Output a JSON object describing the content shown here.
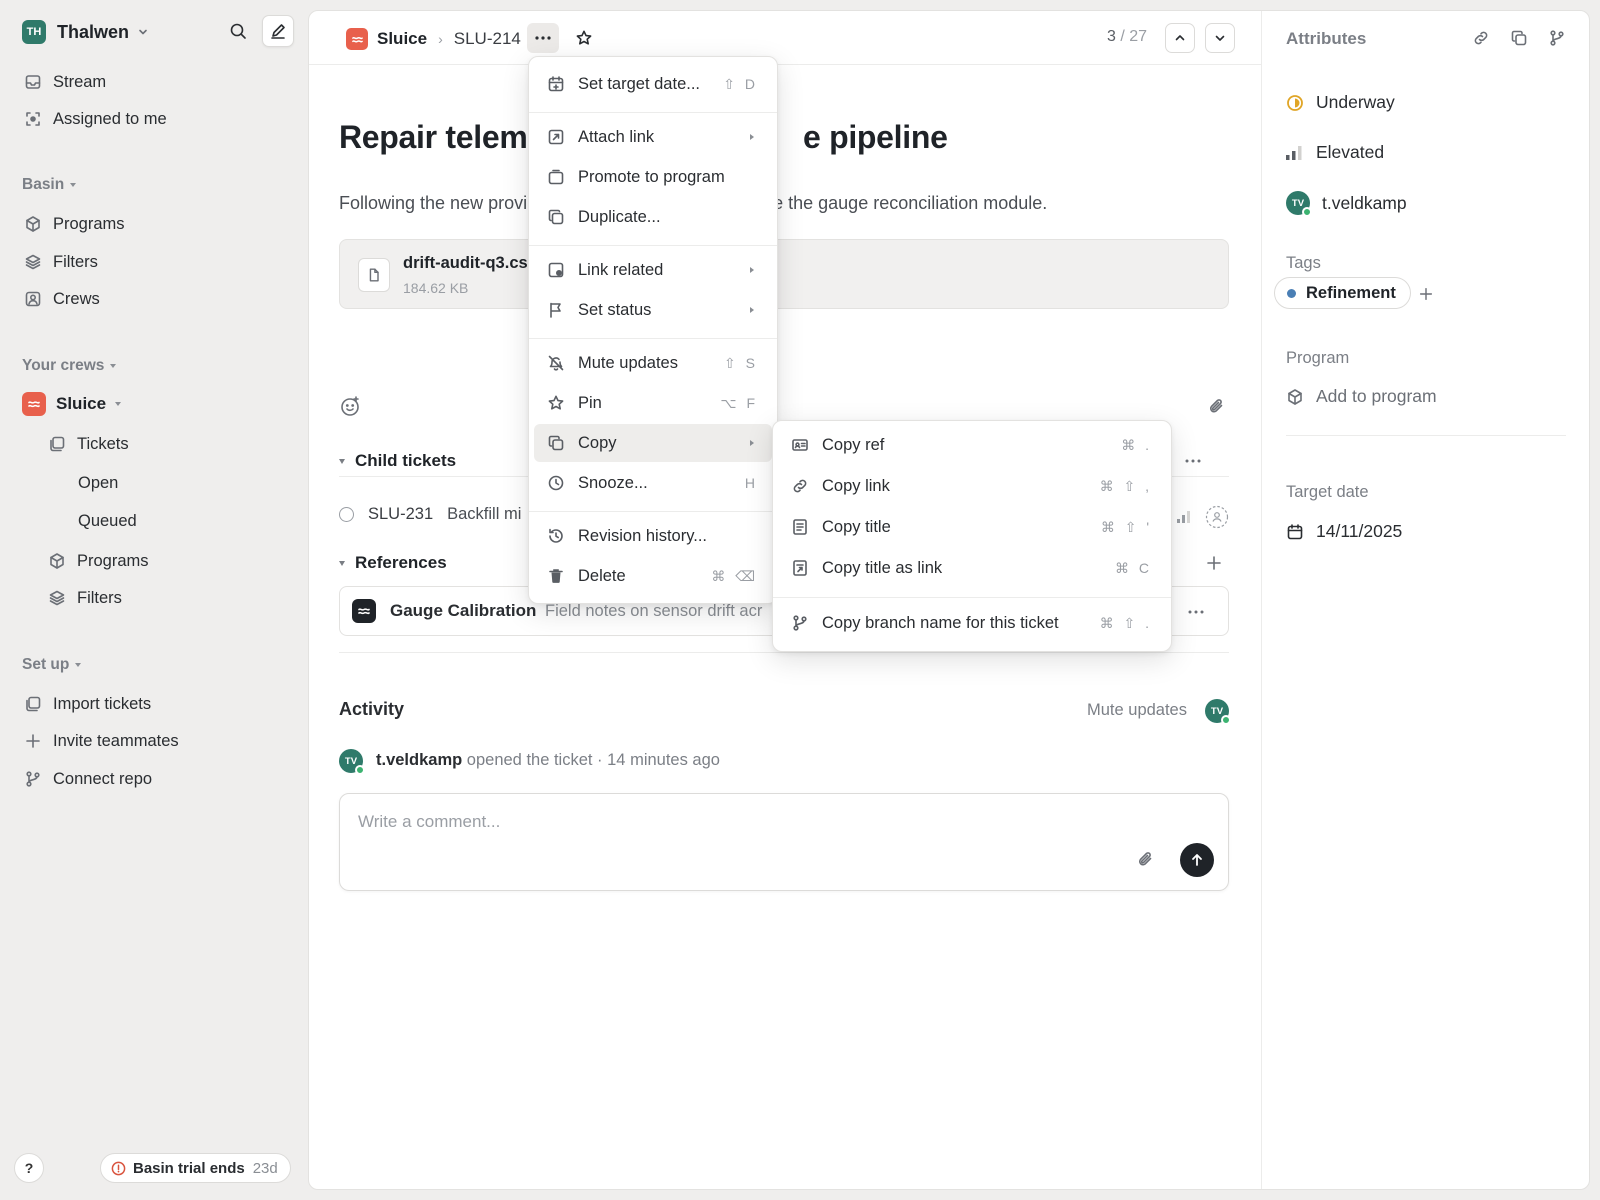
{
  "sidebar": {
    "workspace": {
      "initials": "TH",
      "name": "Thalwen"
    },
    "top_nav": [
      {
        "label": "Stream",
        "icon": "inbox-icon"
      },
      {
        "label": "Assigned to me",
        "icon": "target-icon"
      }
    ],
    "basin": {
      "label": "Basin",
      "items": [
        {
          "label": "Programs",
          "icon": "cube-icon"
        },
        {
          "label": "Filters",
          "icon": "layers-icon"
        },
        {
          "label": "Crews",
          "icon": "crew-icon"
        }
      ]
    },
    "your_crews": {
      "label": "Your crews",
      "crew": {
        "name": "Sluice"
      },
      "tickets_label": "Tickets",
      "ticket_sub": [
        "Open",
        "Queued"
      ],
      "programs_label": "Programs",
      "filters_label": "Filters"
    },
    "setup": {
      "label": "Set up",
      "items": [
        {
          "label": "Import tickets",
          "icon": "import-icon"
        },
        {
          "label": "Invite teammates",
          "icon": "plus-icon"
        },
        {
          "label": "Connect repo",
          "icon": "branch-icon"
        }
      ]
    },
    "help_label": "?",
    "trial": {
      "text": "Basin trial ends",
      "days": "23d"
    }
  },
  "header": {
    "crew": "Sluice",
    "ticket_id": "SLU-214",
    "pager_current": "3",
    "pager_total": "/ 27"
  },
  "ticket": {
    "title_left": "Repair teleme",
    "title_right": "e pipeline",
    "desc_left": "Following the new provi",
    "desc_right": "e the gauge reconciliation module.",
    "attachment": {
      "name": "drift-audit-q3.cs",
      "size": "184.62 KB"
    },
    "child_tickets_label": "Child tickets",
    "child": {
      "id": "SLU-231",
      "title": "Backfill mi"
    },
    "references_label": "References",
    "reference": {
      "title": "Gauge Calibration",
      "note": "Field notes on sensor drift acr"
    }
  },
  "activity": {
    "label": "Activity",
    "mute_label": "Mute updates",
    "user": "t.veldkamp",
    "initials": "TV",
    "event": "opened the ticket · 14 minutes ago",
    "comment_placeholder": "Write a comment..."
  },
  "attributes": {
    "header": "Attributes",
    "status": "Underway",
    "priority": "Elevated",
    "assignee": "t.veldkamp",
    "assignee_initials": "TV",
    "tags_label": "Tags",
    "tag": "Refinement",
    "program_label": "Program",
    "add_program": "Add to program",
    "target_label": "Target date",
    "target_date": "14/11/2025"
  },
  "context_menu": [
    {
      "label": "Set target date...",
      "shortcut": "⇧ D",
      "icon": "calendar-plus-icon"
    },
    {
      "label": "Attach link",
      "submenu": true,
      "icon": "attach-link-icon"
    },
    {
      "label": "Promote to program",
      "icon": "promote-icon"
    },
    {
      "label": "Duplicate...",
      "icon": "duplicate-icon"
    },
    {
      "label": "Link related",
      "submenu": true,
      "icon": "link-related-icon"
    },
    {
      "label": "Set status",
      "submenu": true,
      "icon": "flag-icon"
    },
    {
      "label": "Mute updates",
      "shortcut": "⇧ S",
      "icon": "bell-off-icon"
    },
    {
      "label": "Pin",
      "shortcut": "⌥ F",
      "icon": "star-icon"
    },
    {
      "label": "Copy",
      "submenu": true,
      "icon": "copy-icon"
    },
    {
      "label": "Snooze...",
      "shortcut": "H",
      "icon": "clock-icon"
    },
    {
      "label": "Revision history...",
      "icon": "history-icon"
    },
    {
      "label": "Delete",
      "shortcut": "⌘ ⌫",
      "icon": "trash-icon"
    }
  ],
  "copy_submenu": [
    {
      "label": "Copy ref",
      "shortcut": "⌘ .",
      "icon": "id-card-icon"
    },
    {
      "label": "Copy link",
      "shortcut": "⌘ ⇧ ,",
      "icon": "link-icon"
    },
    {
      "label": "Copy title",
      "shortcut": "⌘ ⇧ '",
      "icon": "doc-icon"
    },
    {
      "label": "Copy title as link",
      "shortcut": "⌘ C",
      "icon": "doc-link-icon"
    },
    {
      "label": "Copy branch name for this ticket",
      "shortcut": "⌘ ⇧ .",
      "icon": "branch-icon"
    }
  ],
  "colors": {
    "crew_badge": "#e8604c",
    "avatar": "#2f7a6a",
    "status": "#e0a526",
    "online": "#3cb371",
    "tag_dot": "#4a7fb5"
  }
}
